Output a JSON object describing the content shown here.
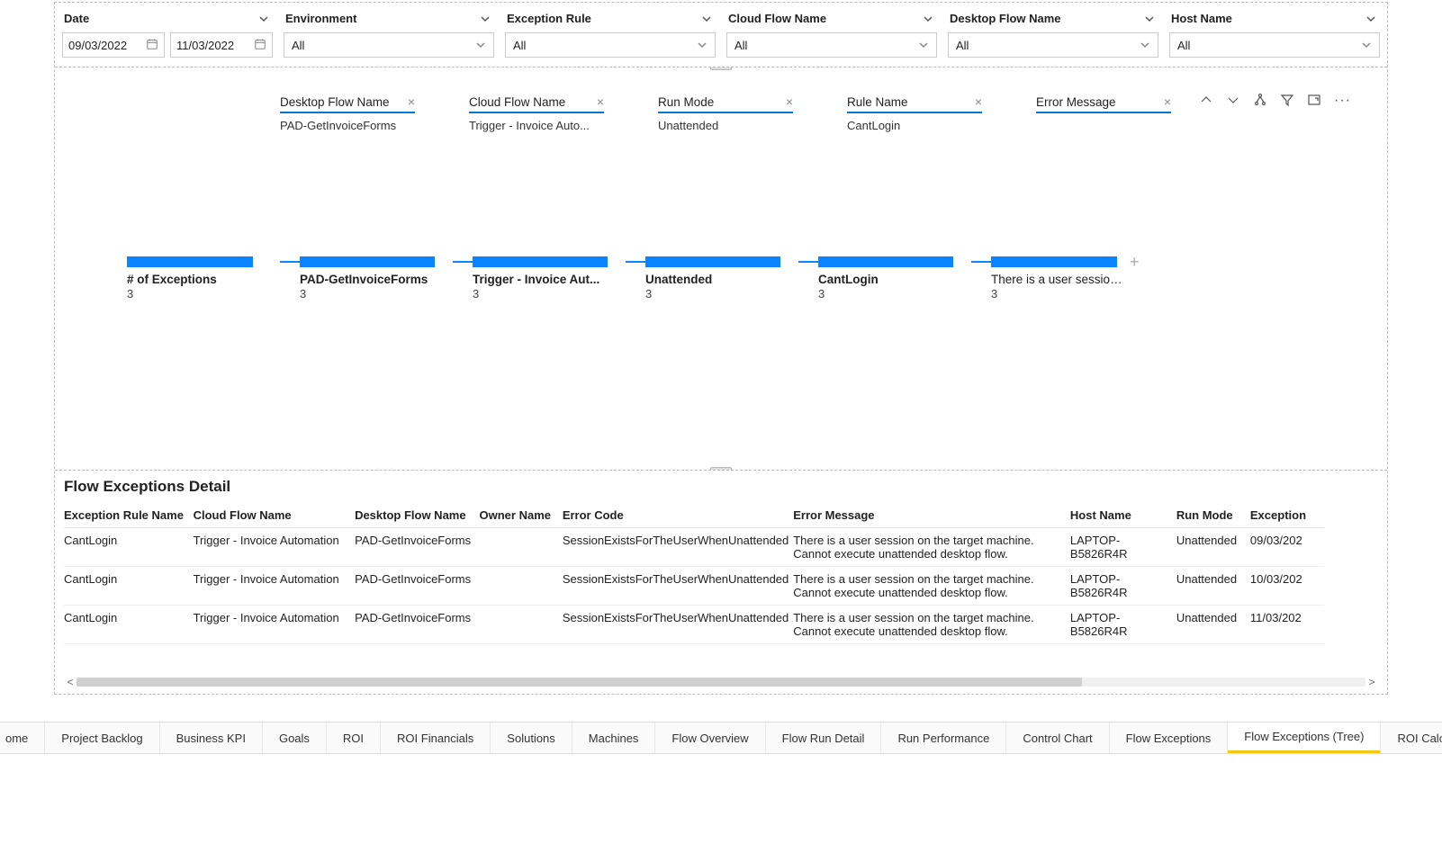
{
  "filters": {
    "date": {
      "label": "Date",
      "from": "09/03/2022",
      "to": "11/03/2022"
    },
    "environment": {
      "label": "Environment",
      "value": "All"
    },
    "exceptionRule": {
      "label": "Exception Rule",
      "value": "All"
    },
    "cloudFlow": {
      "label": "Cloud Flow Name",
      "value": "All"
    },
    "desktopFlow": {
      "label": "Desktop Flow Name",
      "value": "All"
    },
    "hostName": {
      "label": "Host Name",
      "value": "All"
    }
  },
  "crumbs": [
    {
      "header": "Desktop Flow Name",
      "value": "PAD-GetInvoiceForms"
    },
    {
      "header": "Cloud Flow Name",
      "value": "Trigger - Invoice Auto..."
    },
    {
      "header": "Run Mode",
      "value": "Unattended"
    },
    {
      "header": "Rule Name",
      "value": "CantLogin"
    },
    {
      "header": "Error Message",
      "value": ""
    }
  ],
  "nodes": [
    {
      "label": "# of Exceptions",
      "count": "3"
    },
    {
      "label": "PAD-GetInvoiceForms",
      "count": "3"
    },
    {
      "label": "Trigger - Invoice Aut...",
      "count": "3"
    },
    {
      "label": "Unattended",
      "count": "3"
    },
    {
      "label": "CantLogin",
      "count": "3"
    },
    {
      "label": "There is a user session ...",
      "count": "3"
    }
  ],
  "detail": {
    "title": "Flow Exceptions Detail",
    "headers": {
      "rule": "Exception Rule Name",
      "cloud": "Cloud Flow Name",
      "desktop": "Desktop Flow Name",
      "owner": "Owner Name",
      "errorCode": "Error Code",
      "errorMsg": "Error Message",
      "host": "Host Name",
      "mode": "Run Mode",
      "exception": "Exception"
    },
    "rows": [
      {
        "rule": "CantLogin",
        "cloud": "Trigger - Invoice Automation",
        "desktop": "PAD-GetInvoiceForms",
        "owner": "",
        "errorCode": "SessionExistsForTheUserWhenUnattended",
        "errorMsg": "There is a user session on the target machine. Cannot execute unattended desktop flow.",
        "host": "LAPTOP-B5826R4R",
        "mode": "Unattended",
        "exception": "09/03/202"
      },
      {
        "rule": "CantLogin",
        "cloud": "Trigger - Invoice Automation",
        "desktop": "PAD-GetInvoiceForms",
        "owner": "",
        "errorCode": "SessionExistsForTheUserWhenUnattended",
        "errorMsg": "There is a user session on the target machine. Cannot execute unattended desktop flow.",
        "host": "LAPTOP-B5826R4R",
        "mode": "Unattended",
        "exception": "10/03/202"
      },
      {
        "rule": "CantLogin",
        "cloud": "Trigger - Invoice Automation",
        "desktop": "PAD-GetInvoiceForms",
        "owner": "",
        "errorCode": "SessionExistsForTheUserWhenUnattended",
        "errorMsg": "There is a user session on the target machine. Cannot execute unattended desktop flow.",
        "host": "LAPTOP-B5826R4R",
        "mode": "Unattended",
        "exception": "11/03/202"
      }
    ]
  },
  "tabs": [
    "ome",
    "Project Backlog",
    "Business KPI",
    "Goals",
    "ROI",
    "ROI Financials",
    "Solutions",
    "Machines",
    "Flow Overview",
    "Flow Run Detail",
    "Run Performance",
    "Control Chart",
    "Flow Exceptions",
    "Flow Exceptions (Tree)",
    "ROI Calculations"
  ],
  "activeTab": "Flow Exceptions (Tree)"
}
